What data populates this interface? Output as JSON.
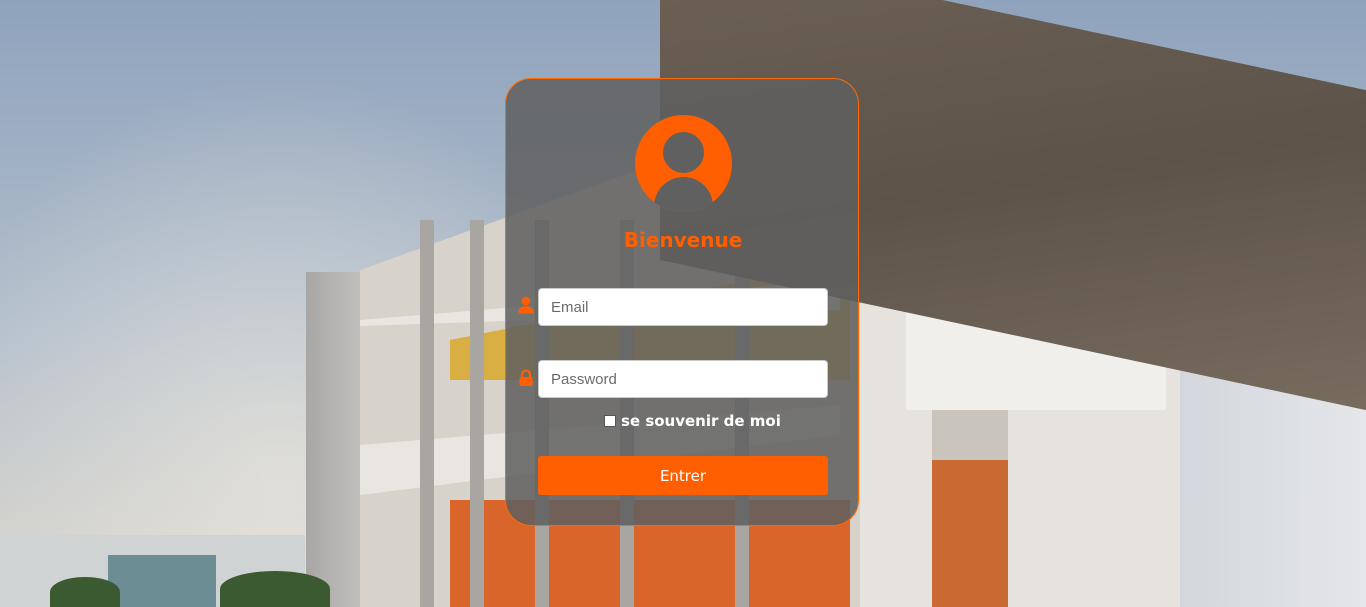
{
  "login": {
    "title": "Bienvenue",
    "email_placeholder": "Email",
    "password_placeholder": "Password",
    "remember_label": "se souvenir de moi",
    "submit_label": "Entrer"
  },
  "icons": {
    "avatar": "user-avatar-icon",
    "email": "user-icon",
    "password": "lock-icon"
  },
  "colors": {
    "accent": "#ff5f00",
    "card_background": "rgba(96,96,96,0.86)",
    "card_border": "#ff6a00"
  }
}
